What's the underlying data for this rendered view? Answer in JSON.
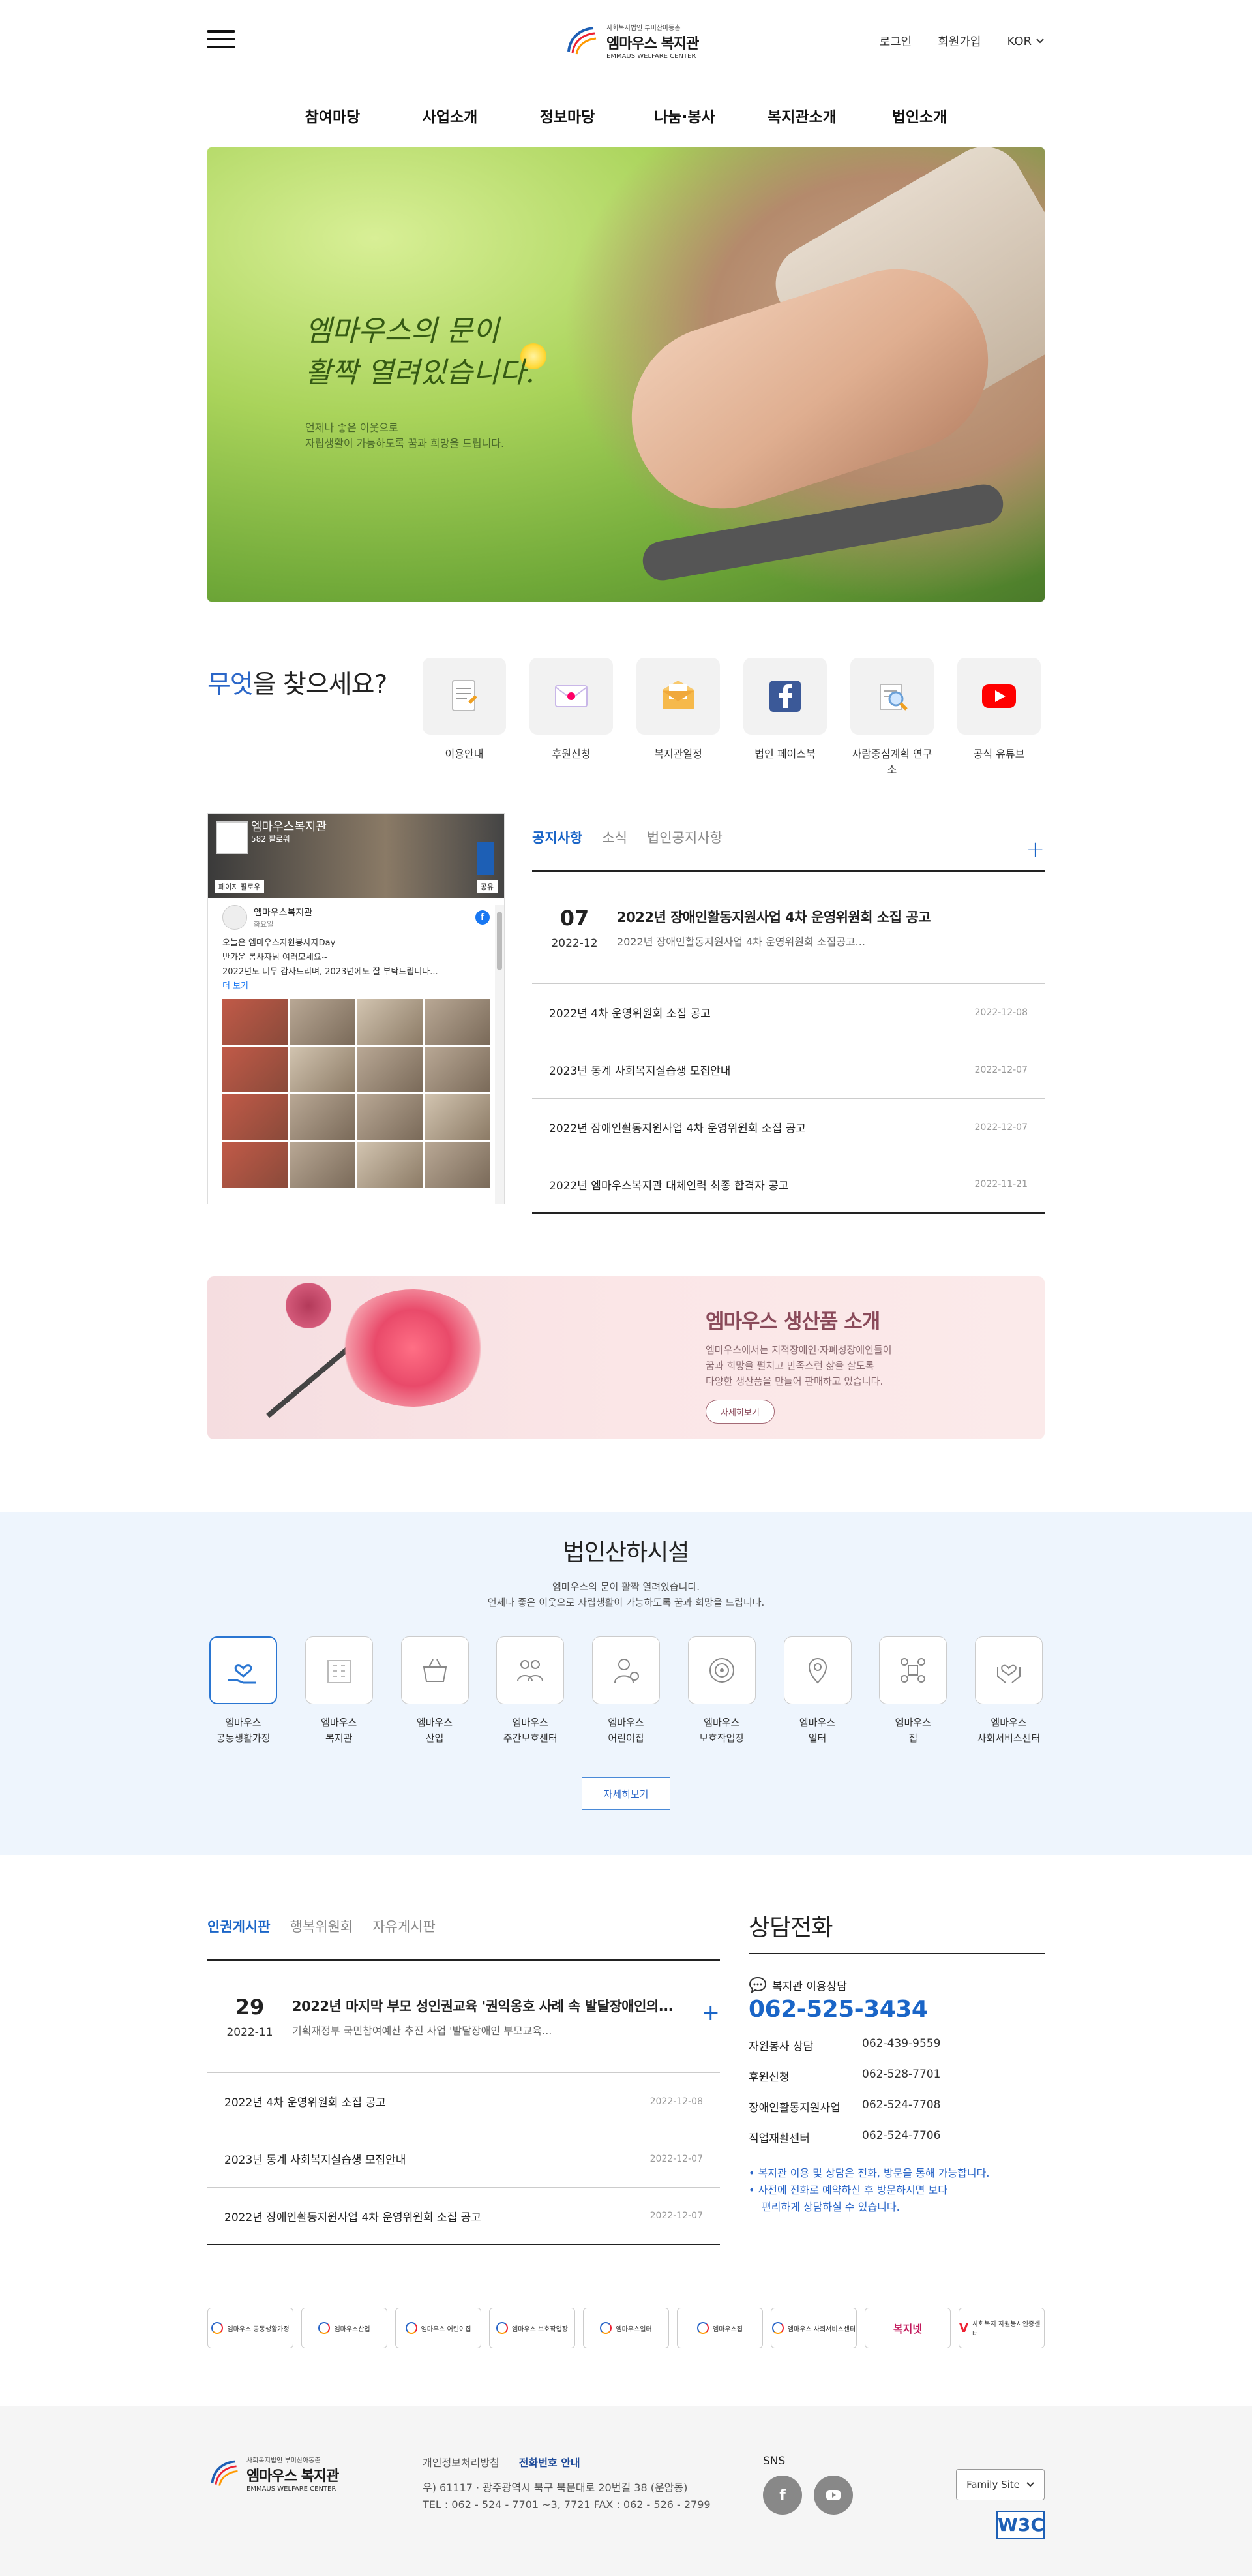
{
  "header": {
    "logo_sub": "사회복지법인 부미산아동촌",
    "logo_main": "엠마우스 복지관",
    "logo_en": "EMMAUS WELFARE CENTER",
    "login": "로그인",
    "signup": "회원가입",
    "lang": "KOR"
  },
  "nav": [
    "참여마당",
    "사업소개",
    "정보마당",
    "나눔·봉사",
    "복지관소개",
    "법인소개"
  ],
  "hero": {
    "title_1": "엠마우스의 문이",
    "title_2": "활짝 열려있습니다.",
    "desc_1": "언제나 좋은 이웃으로",
    "desc_2": "자립생활이 가능하도록 꿈과 희망을 드립니다."
  },
  "find": {
    "title_accent": "무엇",
    "title_rest": "을 찾으세요?",
    "items": [
      {
        "label": "이용안내",
        "icon": "guide-book-icon"
      },
      {
        "label": "후원신청",
        "icon": "donation-envelope-icon"
      },
      {
        "label": "복지관일정",
        "icon": "schedule-mail-icon"
      },
      {
        "label": "법인 페이스북",
        "icon": "facebook-icon"
      },
      {
        "label": "사람중심계획 연구소",
        "icon": "research-icon"
      },
      {
        "label": "공식 유튜브",
        "icon": "youtube-icon"
      }
    ]
  },
  "facebook": {
    "page_name": "엠마우스복지관",
    "likes_label": "582 팔로워",
    "like_btn": "페이지 팔로우",
    "share_btn": "공유",
    "post_name": "엠마우스복지관",
    "post_date": "화요일",
    "post_line1": "오늘은 엠마우스자원봉사자Day",
    "post_line2": "반가운 봉사자님 여러모세요~",
    "post_line3": "2022년도 너무 감사드리며, 2023년에도 잘 부탁드립니다...",
    "more": "더 보기"
  },
  "notice": {
    "tabs": [
      "공지사항",
      "소식",
      "법인공지사항"
    ],
    "plus": "+",
    "feature": {
      "day": "07",
      "ym": "2022-12",
      "title": "2022년 장애인활동지원사업 4차 운영위원회 소집 공고",
      "desc": "2022년 장애인활동지원사업 4차 운영위원회 소집공고..."
    },
    "items": [
      {
        "title": "2022년 4차 운영위원회 소집 공고",
        "date": "2022-12-08"
      },
      {
        "title": "2023년 동계 사회복지실습생 모집안내",
        "date": "2022-12-07"
      },
      {
        "title": "2022년 장애인활동지원사업 4차 운영위원회 소집 공고",
        "date": "2022-12-07"
      },
      {
        "title": "2022년 엠마우스복지관 대체인력 최종 합격자 공고",
        "date": "2022-11-21"
      }
    ]
  },
  "banner": {
    "title": "엠마우스 생산품 소개",
    "line1": "엠마우스에서는 지적장애인·자폐성장애인들이",
    "line2": "꿈과 희망을 펼치고 만족스런 삶을 살도록",
    "line3": "다양한 생산품을 만들어 판매하고 있습니다.",
    "btn": "자세히보기"
  },
  "facilities": {
    "title": "법인산하시설",
    "desc1": "엠마우스의 문이 활짝 열려있습니다.",
    "desc2": "언제나 좋은 이웃으로 자립생활이 가능하도록 꿈과 희망을 드립니다.",
    "items": [
      {
        "l1": "엠마우스",
        "l2": "공동생활가정",
        "icon": "hand-heart-icon"
      },
      {
        "l1": "엠마우스",
        "l2": "복지관",
        "icon": "building-icon"
      },
      {
        "l1": "엠마우스",
        "l2": "산업",
        "icon": "basket-icon"
      },
      {
        "l1": "엠마우스",
        "l2": "주간보호센터",
        "icon": "people-icon"
      },
      {
        "l1": "엠마우스",
        "l2": "어린이집",
        "icon": "child-icon"
      },
      {
        "l1": "엠마우스",
        "l2": "보호작업장",
        "icon": "target-icon"
      },
      {
        "l1": "엠마우스",
        "l2": "일터",
        "icon": "location-icon"
      },
      {
        "l1": "엠마우스",
        "l2": "집",
        "icon": "network-icon"
      },
      {
        "l1": "엠마우스",
        "l2": "사회서비스센터",
        "icon": "hands-heart-icon"
      }
    ],
    "more": "자세히보기"
  },
  "board2": {
    "tabs": [
      "인권게시판",
      "행복위원회",
      "자유게시판"
    ],
    "plus": "+",
    "feature": {
      "day": "29",
      "ym": "2022-11",
      "title": "2022년 마지막 부모 성인권교육 '권익옹호 사례 속 발달장애인의...",
      "desc": "기획재정부 국민참여예산 추진 사업 '발달장애인 부모교육..."
    },
    "items": [
      {
        "title": "2022년 4차 운영위원회 소집 공고",
        "date": "2022-12-08"
      },
      {
        "title": "2023년 동계 사회복지실습생 모집안내",
        "date": "2022-12-07"
      },
      {
        "title": "2022년 장애인활동지원사업 4차 운영위원회 소집 공고",
        "date": "2022-12-07"
      }
    ]
  },
  "counsel": {
    "title": "상담전화",
    "main_label": "복지관 이용상담",
    "main_num": "062-525-3434",
    "rows": [
      {
        "k": "자원봉사 상담",
        "v": "062-439-9559"
      },
      {
        "k": "후원신청",
        "v": "062-528-7701"
      },
      {
        "k": "장애인활동지원사업",
        "v": "062-524-7708"
      },
      {
        "k": "직업재활센터",
        "v": "062-524-7706"
      }
    ],
    "note1": "• 복지관 이용 및 상담은 전화, 방문을 통해 가능합니다.",
    "note2": "• 사전에 전화로 예약하신 후 방문하시면 보다",
    "note3": "편리하게 상담하실 수 있습니다."
  },
  "links": [
    "엠마우스 공동생활가정",
    "엠마우스산업",
    "엠마우스 어린이집",
    "엠마우스 보호작업장",
    "엠마우스일터",
    "엠마우스집",
    "엠마우스 사회서비스센터",
    "복지넷",
    "사회복지 자원봉사인증센터"
  ],
  "footer": {
    "privacy": "개인정보처리방침",
    "email": "전화번호 안내",
    "addr": "우) 61117 · 광주광역시 북구 북문대로 20번길 38 (운암동)",
    "tel": "TEL : 062 - 524 - 7701 ~3, 7721 FAX : 062 - 526 - 2799",
    "sns": "SNS",
    "family": "Family Site",
    "w3c": "W3C"
  }
}
